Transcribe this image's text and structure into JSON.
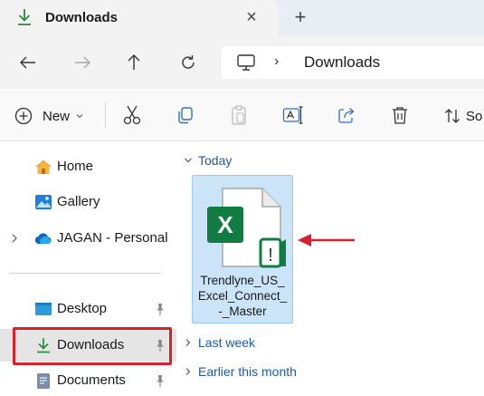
{
  "tab": {
    "title": "Downloads",
    "close_glyph": "×",
    "new_glyph": "+"
  },
  "address": {
    "separator": "›",
    "location": "Downloads"
  },
  "commands": {
    "new_label": "New",
    "sort_label": "So"
  },
  "sidebar": {
    "items": [
      {
        "label": "Home",
        "icon": "home-icon"
      },
      {
        "label": "Gallery",
        "icon": "gallery-icon"
      },
      {
        "label": "JAGAN - Personal",
        "icon": "onedrive-cloud-icon"
      },
      {
        "label": "Desktop",
        "icon": "desktop-icon"
      },
      {
        "label": "Downloads",
        "icon": "download-icon"
      },
      {
        "label": "Documents",
        "icon": "documents-icon"
      }
    ]
  },
  "content": {
    "groups": [
      {
        "label": "Today",
        "expanded": true
      },
      {
        "label": "Last week",
        "expanded": false
      },
      {
        "label": "Earlier this month",
        "expanded": false
      }
    ],
    "file": {
      "name_line1": "Trendlyne_US_",
      "name_line2": "Excel_Connect_",
      "name_line3": "-_Master",
      "icon": "excel-file-warning-icon",
      "icon_letter": "X",
      "badge_glyph": "!"
    }
  },
  "colors": {
    "accent": "#0067c0",
    "excel_green": "#107c41",
    "selection": "#cce4f7",
    "highlight_red": "#d9202a"
  }
}
